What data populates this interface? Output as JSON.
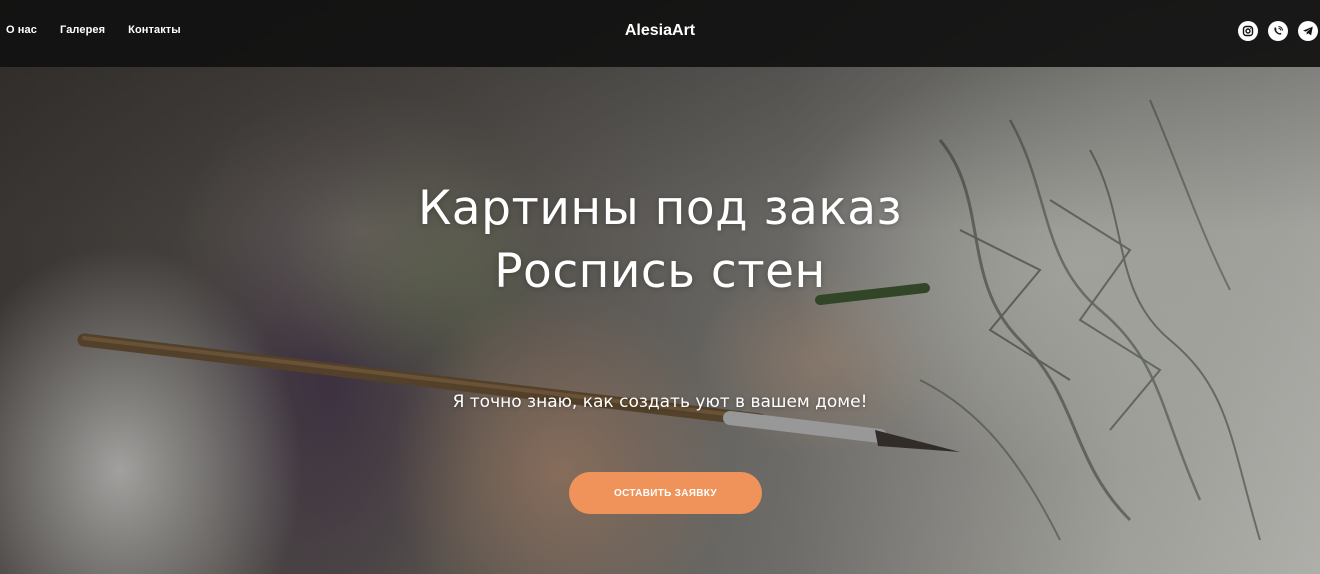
{
  "header": {
    "nav": [
      {
        "label": "О нас"
      },
      {
        "label": "Галерея"
      },
      {
        "label": "Контакты"
      }
    ],
    "logo": "AlesiaArt",
    "socials": [
      {
        "icon": "instagram-icon"
      },
      {
        "icon": "viber-icon"
      },
      {
        "icon": "telegram-icon"
      }
    ]
  },
  "hero": {
    "title_line1": "Картины под заказ",
    "title_line2": "Роспись стен",
    "subtitle": "Я точно знаю, как создать уют в вашем доме!",
    "cta_label": "ОСТАВИТЬ ЗАЯВКУ"
  },
  "colors": {
    "header_bg": "#111111",
    "accent": "#f0935a",
    "text": "#ffffff"
  }
}
